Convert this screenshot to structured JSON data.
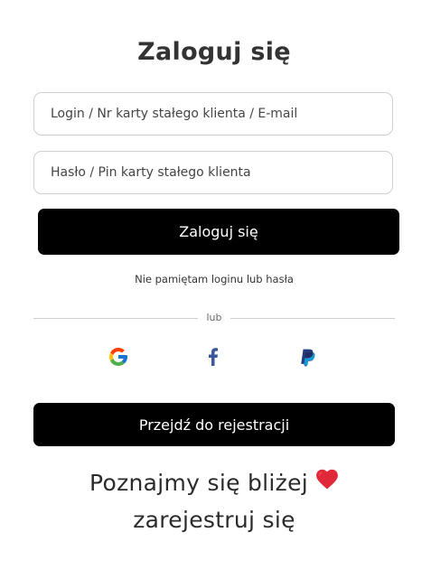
{
  "title": "Zaloguj się",
  "form": {
    "login_placeholder": "Login / Nr karty stałego klienta / E-mail",
    "password_placeholder": "Hasło / Pin karty stałego klienta",
    "submit_label": "Zaloguj się",
    "forgot_label": "Nie pamiętam loginu lub hasła"
  },
  "divider_label": "lub",
  "social": [
    {
      "icon": "google-icon"
    },
    {
      "icon": "facebook-icon"
    },
    {
      "icon": "paypal-icon"
    }
  ],
  "register_label": "Przejdź do rejestracji",
  "promo": {
    "line1": "Poznajmy się bliżej",
    "line2": "zarejestruj się",
    "icon": "heart-icon"
  },
  "colors": {
    "button_bg": "#000000",
    "button_text": "#ffffff",
    "border": "#cfcfcf",
    "heart": "#e0283a",
    "facebook": "#3b5998",
    "paypal_dark": "#253b80",
    "paypal_light": "#179bd7"
  }
}
